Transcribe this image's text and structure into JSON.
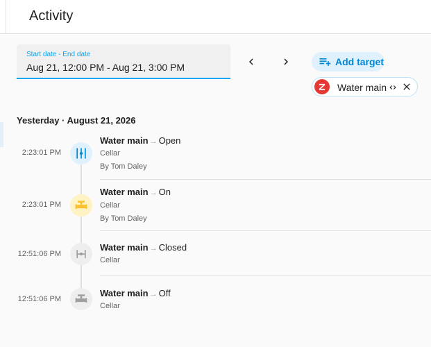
{
  "header": {
    "title": "Activity"
  },
  "date_picker": {
    "label": "Start date - End date",
    "value": "Aug 21, 12:00 PM - Aug 21, 3:00 PM"
  },
  "targets": {
    "add_label": "Add target",
    "chips": [
      {
        "label": "Water main"
      }
    ]
  },
  "day": {
    "header": "Yesterday · August 21, 2026"
  },
  "entries": [
    {
      "time": "2:23:01 PM",
      "name": "Water main",
      "arrow": "→",
      "state": "Open",
      "area": "Cellar",
      "user": "By Tom Daley",
      "icon": "valve-open-icon"
    },
    {
      "time": "2:23:01 PM",
      "name": "Water main",
      "arrow": "→",
      "state": "On",
      "area": "Cellar",
      "user": "By Tom Daley",
      "icon": "pipe-valve-icon"
    },
    {
      "time": "12:51:06 PM",
      "name": "Water main",
      "arrow": "→",
      "state": "Closed",
      "area": "Cellar",
      "user": "",
      "icon": "valve-closed-icon"
    },
    {
      "time": "12:51:06 PM",
      "name": "Water main",
      "arrow": "→",
      "state": "Off",
      "area": "Cellar",
      "user": "",
      "icon": "pipe-valve-icon"
    }
  ],
  "colors": {
    "accent": "#03a9f4",
    "active_icon_bg": "#dff1fd",
    "on_icon_bg": "#fff3c4",
    "on_icon_fg": "#fbc02d",
    "off_icon_bg": "#eeeeee",
    "off_icon_fg": "#9e9e9e"
  }
}
